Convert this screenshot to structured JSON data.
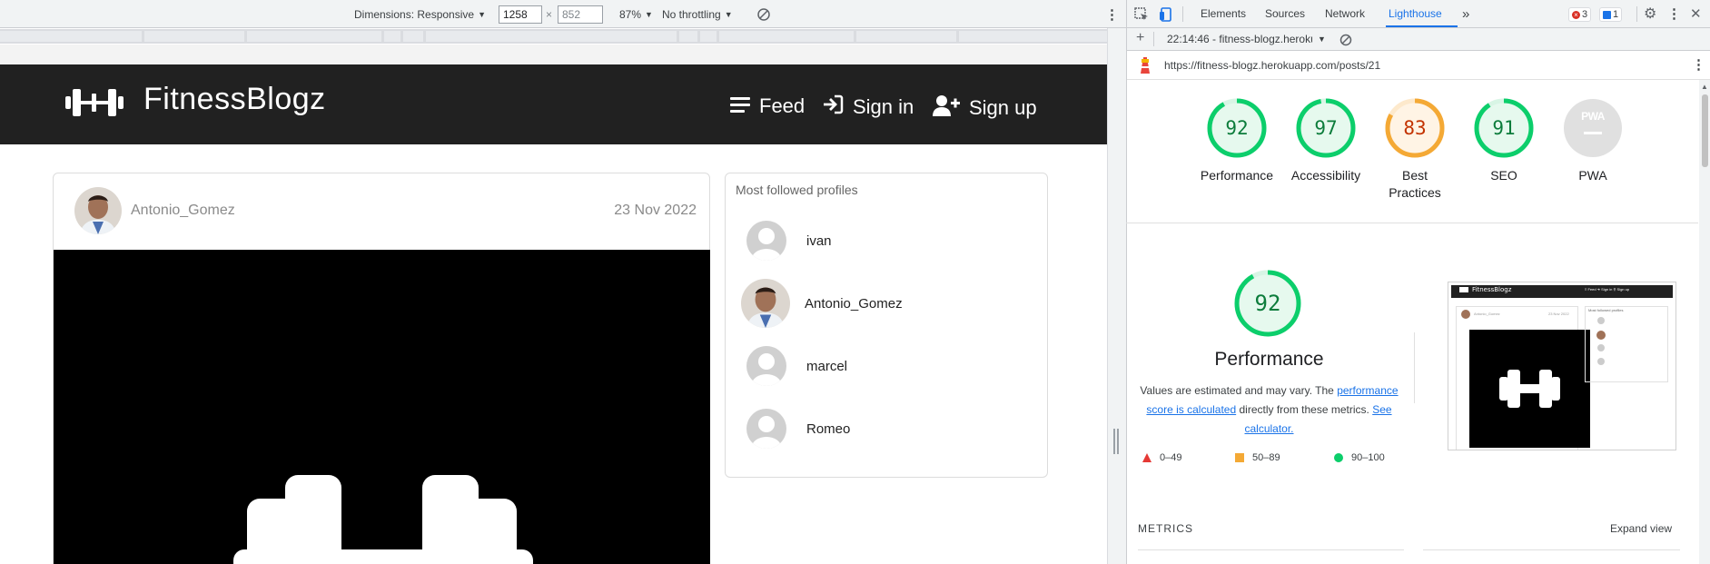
{
  "device_toolbar": {
    "dimensions_label": "Dimensions: Responsive",
    "width_value": "1258",
    "times_sign": "×",
    "height_value": "852",
    "zoom": "87%",
    "throttling": "No throttling"
  },
  "site": {
    "brand": "FitnessBlogz",
    "nav": {
      "feed": "Feed",
      "sign_in": "Sign in",
      "sign_up": "Sign up"
    },
    "post": {
      "author": "Antonio_Gomez",
      "date": "23 Nov 2022"
    },
    "profiles": {
      "title": "Most followed profiles",
      "items": [
        {
          "name": "ivan",
          "avatar": "default"
        },
        {
          "name": "Antonio_Gomez",
          "avatar": "photo"
        },
        {
          "name": "marcel",
          "avatar": "default"
        },
        {
          "name": "Romeo",
          "avatar": "default"
        }
      ]
    }
  },
  "devtools": {
    "tabs": {
      "elements": "Elements",
      "sources": "Sources",
      "network": "Network",
      "lighthouse": "Lighthouse",
      "more": "»"
    },
    "errors_count": "3",
    "messages_count": "1",
    "report_selector": "22:14:46 - fitness-blogz.heroku",
    "url": "https://fitness-blogz.herokuapp.com/posts/21"
  },
  "lighthouse": {
    "scores": [
      {
        "label": "Performance",
        "value": 92,
        "status": "pass"
      },
      {
        "label": "Accessibility",
        "value": 97,
        "status": "pass"
      },
      {
        "label": "Best Practices",
        "value": 83,
        "status": "average"
      },
      {
        "label": "SEO",
        "value": 91,
        "status": "pass"
      }
    ],
    "pwa": {
      "label": "PWA",
      "badge_text": "PWA"
    },
    "performance": {
      "score": 92,
      "title": "Performance",
      "desc_prefix": "Values are estimated and may vary. The",
      "desc_link": "performance score is calculated",
      "desc_middle": "directly from these metrics.",
      "desc_link2": "See calculator."
    },
    "legend": [
      {
        "range": "0–49",
        "color": "#e53935",
        "shape": "triangle"
      },
      {
        "range": "50–89",
        "color": "#f4a935",
        "shape": "square"
      },
      {
        "range": "90–100",
        "color": "#0cce6b",
        "shape": "circle"
      }
    ],
    "thumb": {
      "brand": "FitnessBlogz",
      "nav": "≡ Feed   ➜ Sign in   ⚲ Sign up",
      "author": "Antonio_Gomez",
      "date": "23 Nov 2022",
      "profiles_title": "Most followed profiles"
    },
    "metrics_label": "METRICS",
    "expand_view": "Expand view"
  },
  "colors": {
    "pass": "#0cce6b",
    "pass_text": "#0c7c3b",
    "average": "#f4a935",
    "average_text": "#c33300",
    "navbar": "#212121",
    "accent": "#1a73e8"
  }
}
